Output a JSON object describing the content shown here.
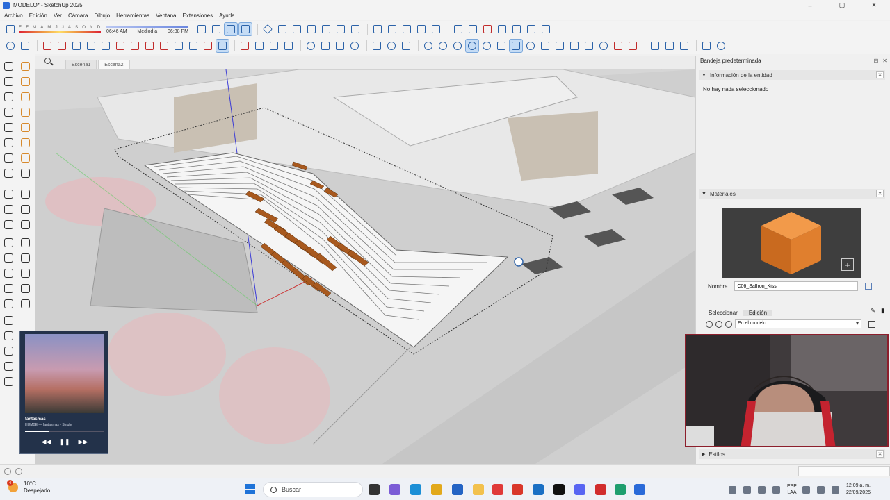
{
  "window": {
    "title": "MODELO* - SketchUp 2025",
    "controls": [
      "–",
      "▢",
      "✕"
    ]
  },
  "menu": [
    "Archivo",
    "Edición",
    "Ver",
    "Cámara",
    "Dibujo",
    "Herramientas",
    "Ventana",
    "Extensiones",
    "Ayuda"
  ],
  "shadows": {
    "months": [
      "E",
      "F",
      "M",
      "A",
      "M",
      "J",
      "J",
      "A",
      "S",
      "O",
      "N",
      "D"
    ],
    "sunrise": "06:46 AM",
    "noon": "Mediodía",
    "sunset": "06:38 PM"
  },
  "scenes": {
    "tabs": [
      "Escena1",
      "Escena2"
    ],
    "active_index": 1
  },
  "music": {
    "song": "fantasmas",
    "artist": "HUMBE — fantasmas - Single",
    "progress_fraction": 0.3,
    "prev": "◀◀",
    "play_pause": "❚❚",
    "next": "▶▶"
  },
  "tray": {
    "title": "Bandeja predeterminada",
    "pin": "⊡",
    "close": "✕",
    "entity_info": {
      "header": "Información de la entidad",
      "body": "No hay nada seleccionado"
    },
    "materials": {
      "header": "Materiales",
      "name_label": "Nombre",
      "name_value": "C06_Saffron_Kiss",
      "tabs": [
        "Seleccionar",
        "Edición"
      ],
      "active_tab": 1,
      "collection": "En el modelo",
      "swatch_color": "#e98b3a",
      "add_symbol": "+"
    },
    "styles": {
      "header": "Estilos"
    }
  },
  "taskbar": {
    "weather_temp": "10°C",
    "weather_desc": "Despejado",
    "weather_badge": "4",
    "search_placeholder": "Buscar",
    "lang_top": "ESP",
    "lang_bottom": "LAA",
    "time": "12:09 a. m.",
    "date": "22/09/2025"
  },
  "colors": {
    "accent": "#2b62a8",
    "material": "#e98b3a",
    "webcam_border": "#8c1f2c"
  }
}
